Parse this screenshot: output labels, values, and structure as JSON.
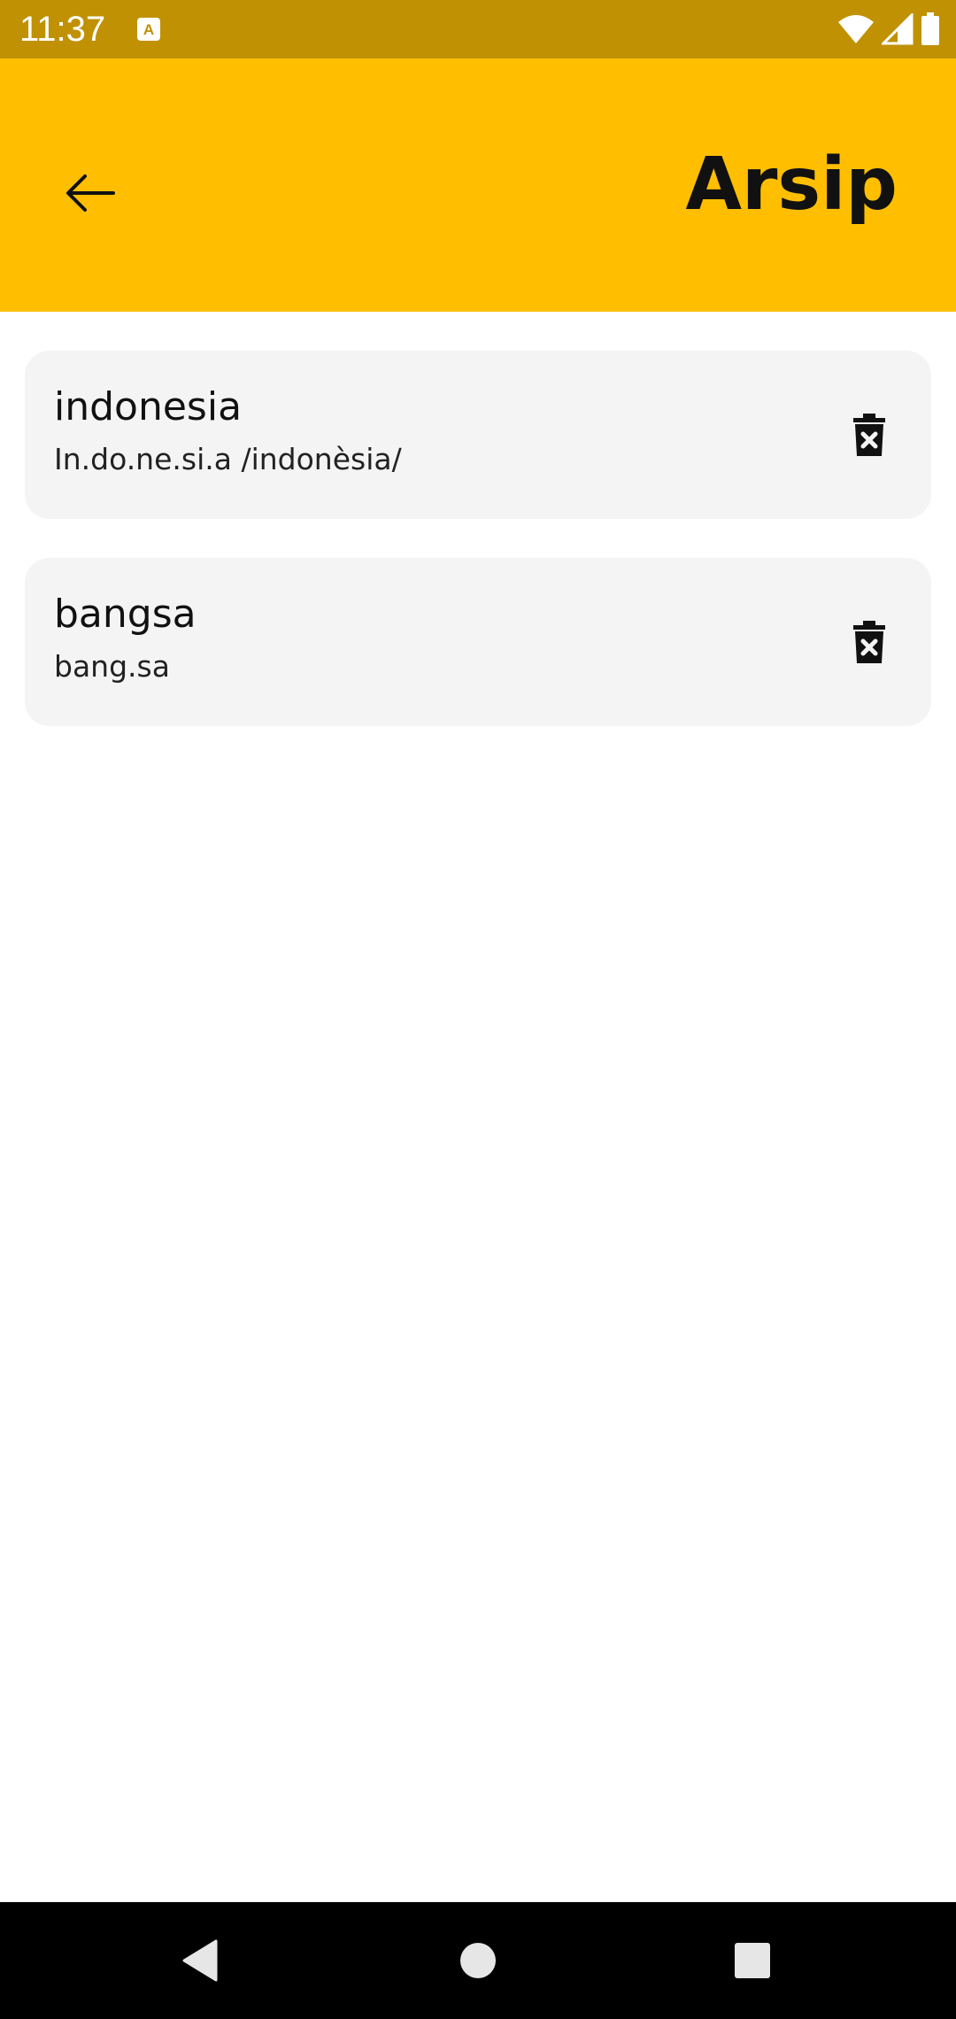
{
  "status_bar": {
    "time": "11:37",
    "notification_icon": "app-notification-icon",
    "icons": [
      "wifi-icon",
      "signal-icon",
      "battery-icon"
    ]
  },
  "app_bar": {
    "title": "Arsip",
    "back_icon": "arrow-back-icon",
    "color": "#FFBF00"
  },
  "items": [
    {
      "word": "indonesia",
      "syllables": "In.do.ne.si.a /indonèsia/",
      "action_icon": "delete-icon"
    },
    {
      "word": "bangsa",
      "syllables": "bang.sa",
      "action_icon": "delete-icon"
    }
  ],
  "nav_bar": {
    "icons": [
      "back-triangle-icon",
      "home-circle-icon",
      "recents-square-icon"
    ]
  },
  "colors": {
    "status_bar": "#C09103",
    "app_bar": "#FFBF00",
    "card": "#F4F4F4",
    "nav_bar": "#000000"
  }
}
